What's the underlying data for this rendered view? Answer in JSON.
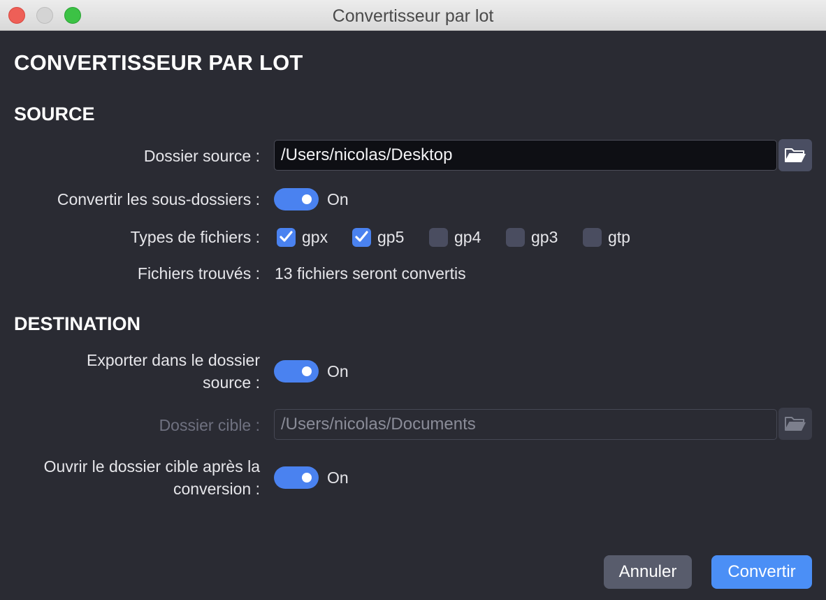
{
  "window": {
    "title": "Convertisseur par lot"
  },
  "page_title": "CONVERTISSEUR PAR LOT",
  "source": {
    "heading": "SOURCE",
    "folder_label": "Dossier source :",
    "folder_value": "/Users/nicolas/Desktop",
    "subfolders_label": "Convertir les sous-dossiers :",
    "subfolders_state": "On",
    "filetypes_label": "Types de fichiers :",
    "filetypes": [
      {
        "label": "gpx",
        "checked": true
      },
      {
        "label": "gp5",
        "checked": true
      },
      {
        "label": "gp4",
        "checked": false
      },
      {
        "label": "gp3",
        "checked": false
      },
      {
        "label": "gtp",
        "checked": false
      }
    ],
    "found_label": "Fichiers trouvés :",
    "found_value": "13 fichiers seront convertis"
  },
  "destination": {
    "heading": "DESTINATION",
    "export_label_line1": "Exporter dans le dossier",
    "export_label_line2": "source :",
    "export_state": "On",
    "target_label": "Dossier cible :",
    "target_value": "/Users/nicolas/Documents",
    "open_label_line1": "Ouvrir le dossier cible après la",
    "open_label_line2": "conversion :",
    "open_state": "On"
  },
  "buttons": {
    "cancel": "Annuler",
    "convert": "Convertir"
  },
  "colors": {
    "accent": "#4a82f0",
    "background": "#2a2b33"
  }
}
